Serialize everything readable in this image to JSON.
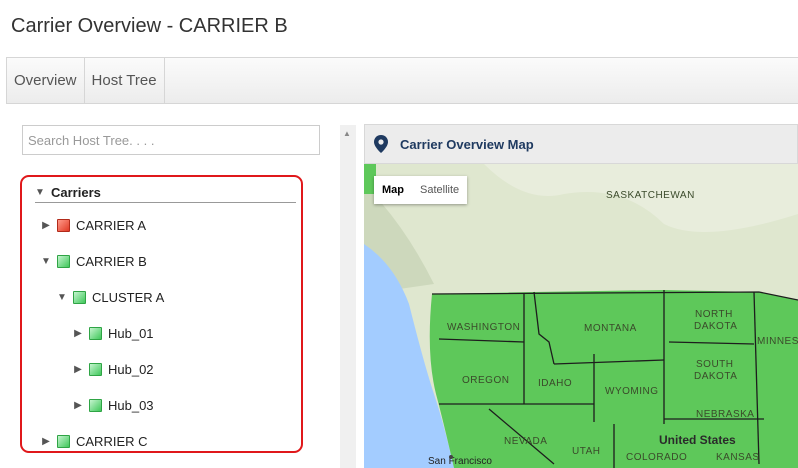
{
  "page": {
    "title": "Carrier Overview - CARRIER B"
  },
  "tabs": [
    {
      "label": "Overview"
    },
    {
      "label": "Host Tree"
    }
  ],
  "search": {
    "placeholder": "Search Host Tree. . . ."
  },
  "tree": {
    "root": {
      "label": "Carriers",
      "expanded": true
    },
    "nodes": [
      {
        "label": "CARRIER A",
        "status": "red",
        "expanded": false,
        "level": 1
      },
      {
        "label": "CARRIER B",
        "status": "green",
        "expanded": true,
        "level": 1
      },
      {
        "label": "CLUSTER A",
        "status": "green",
        "expanded": true,
        "level": 2
      },
      {
        "label": "Hub_01",
        "status": "green",
        "expanded": false,
        "level": 3
      },
      {
        "label": "Hub_02",
        "status": "green",
        "expanded": false,
        "level": 3
      },
      {
        "label": "Hub_03",
        "status": "green",
        "expanded": false,
        "level": 3
      },
      {
        "label": "CARRIER C",
        "status": "green",
        "expanded": false,
        "level": 1
      }
    ]
  },
  "map": {
    "title": "Carrier Overview Map",
    "map_type": [
      "Map",
      "Satellite"
    ],
    "active_type": "Map",
    "labels": {
      "saskatchewan": "SASKATCHEWAN",
      "washington": "WASHINGTON",
      "montana": "MONTANA",
      "north_dakota_1": "NORTH",
      "north_dakota_2": "DAKOTA",
      "minnesota": "MINNESO",
      "oregon": "OREGON",
      "idaho": "IDAHO",
      "wyoming": "WYOMING",
      "south_dakota_1": "SOUTH",
      "south_dakota_2": "DAKOTA",
      "nebraska": "NEBRASKA",
      "nevada": "NEVADA",
      "utah": "UTAH",
      "colorado": "COLORADO",
      "kansas": "KANSAS",
      "country": "United States",
      "city": "San Francisco"
    }
  },
  "colors": {
    "status_green": "#40c75a",
    "status_red": "#e03a25",
    "highlight_border": "#e0181b",
    "region_fill": "#5ec85a",
    "water": "#a3ccff"
  }
}
